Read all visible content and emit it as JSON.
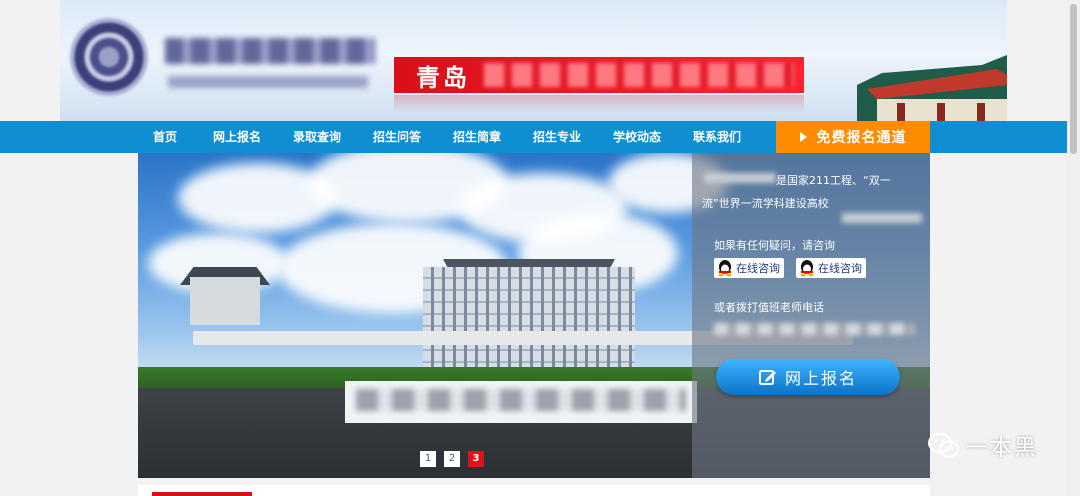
{
  "header": {
    "slogan_city": "青岛"
  },
  "nav": {
    "items": [
      {
        "label": "首页"
      },
      {
        "label": "网上报名"
      },
      {
        "label": "录取查询"
      },
      {
        "label": "招生问答"
      },
      {
        "label": "招生简章"
      },
      {
        "label": "招生专业"
      },
      {
        "label": "学校动态"
      },
      {
        "label": "联系我们"
      }
    ],
    "signup_channel": "免费报名通道",
    "bar_color": "#0f8ed1",
    "channel_color": "#ff8c00"
  },
  "banner": {
    "panel": {
      "intro_line1": "是国家211工程、“双一",
      "intro_line2": "流”世界一流学科建设高校",
      "ask_text": "如果有任何疑问，请咨询",
      "qq_buttons": [
        {
          "label": "在线咨询",
          "icon": "qq-penguin-icon"
        },
        {
          "label": "在线咨询",
          "icon": "qq-penguin-icon"
        }
      ],
      "phone_label": "或者拨打值班老师电话",
      "apply_label": "网上报名",
      "apply_icon": "edit-icon"
    },
    "slides": [
      "1",
      "2",
      "3"
    ],
    "active_slide": "3"
  },
  "watermark": {
    "text": "一本黑",
    "icon": "wechat-icon"
  },
  "colors": {
    "accent_red": "#e0131b"
  }
}
